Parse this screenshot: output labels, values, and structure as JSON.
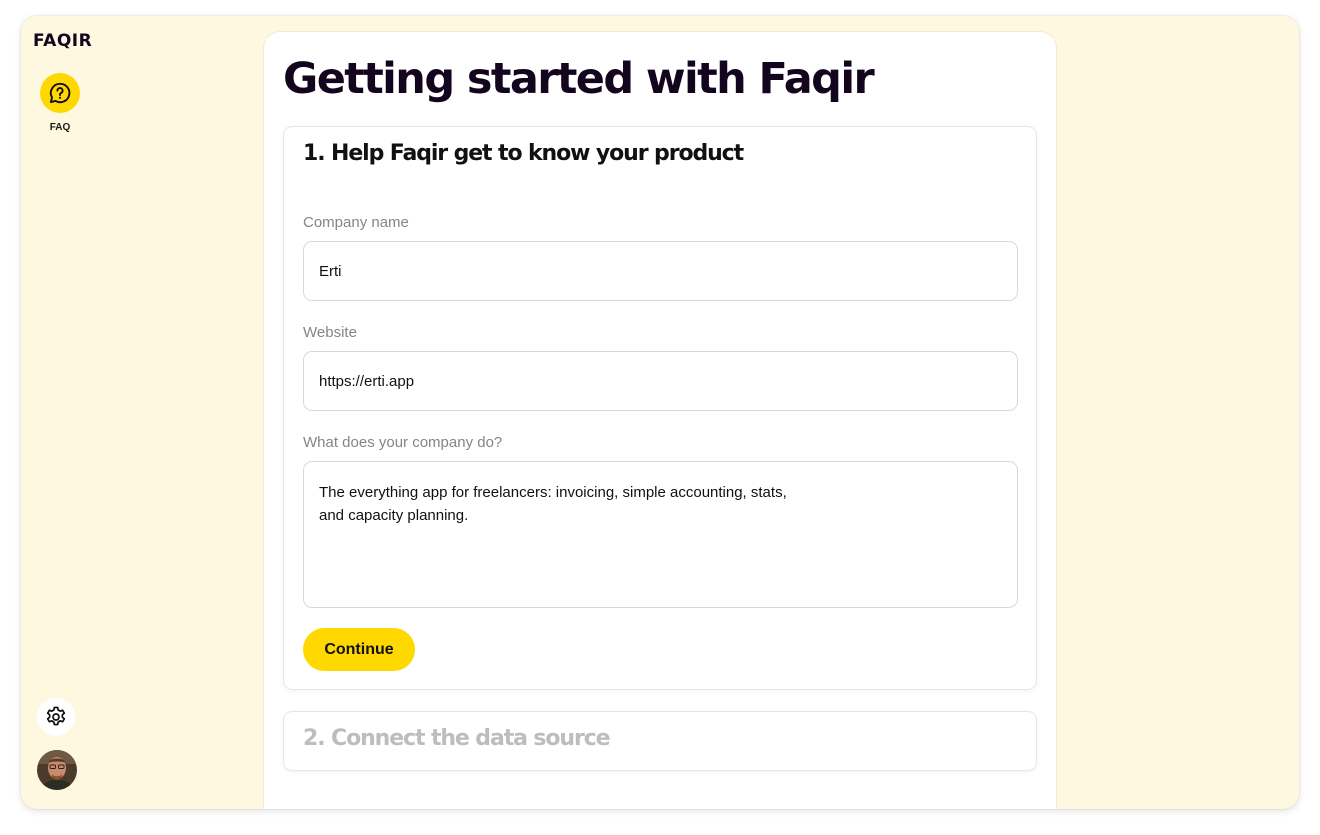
{
  "app": {
    "logo_text": "FAQIR",
    "accent_color": "#ffd800"
  },
  "sidebar": {
    "nav_items": [
      {
        "label": "FAQ",
        "icon": "question-bubble-icon"
      }
    ],
    "settings_icon": "gear-icon",
    "avatar_icon": "user-avatar"
  },
  "main": {
    "title": "Getting started with Faqir",
    "step1": {
      "title": "1. Help Faqir get to know your product",
      "fields": [
        {
          "label": "Company name",
          "value": "Erti"
        },
        {
          "label": "Website",
          "value": "https://erti.app"
        },
        {
          "label": "What does your company do?",
          "value": "The everything app for freelancers: invoicing, simple accounting, stats,\nand capacity planning."
        }
      ],
      "continue_label": "Continue"
    },
    "step2": {
      "title": "2. Connect the data source"
    }
  }
}
